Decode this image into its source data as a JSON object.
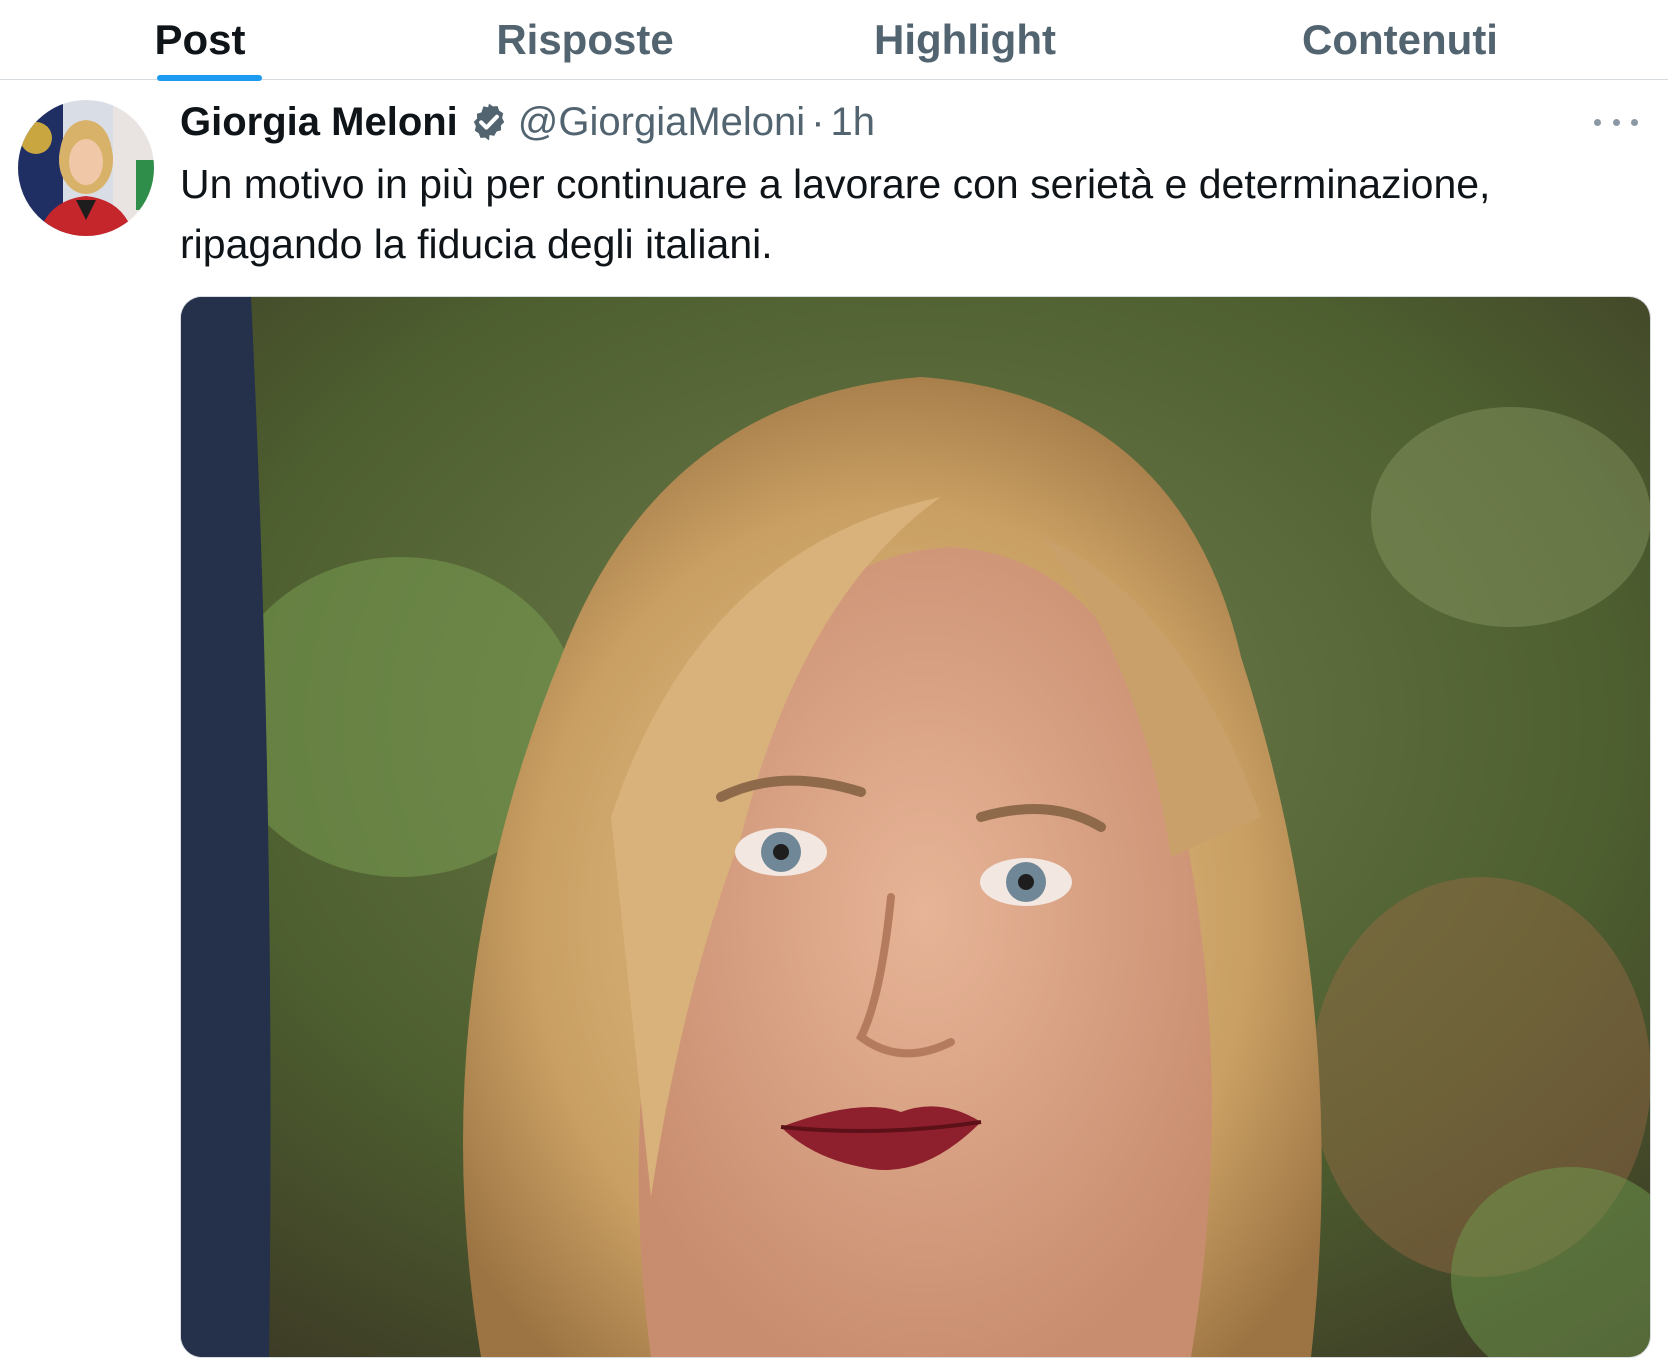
{
  "tabs": [
    {
      "label": "Post",
      "active": true
    },
    {
      "label": "Risposte",
      "active": false
    },
    {
      "label": "Highlight",
      "active": false
    },
    {
      "label": "Contenuti",
      "active": false
    }
  ],
  "tweet": {
    "author": {
      "display_name": "Giorgia Meloni",
      "handle": "@GiorgiaMeloni",
      "verified": true,
      "verified_icon": "verified-badge-icon",
      "avatar_icon": "avatar-photo"
    },
    "separator": "·",
    "time": "1h",
    "text": "Un motivo in più per continuare a lavorare con serietà e determinazione, ripagando la fiducia degli italiani.",
    "more_icon": "more-options-icon",
    "media_icon": "photo-portrait"
  },
  "colors": {
    "accent": "#1d9bf0",
    "text_primary": "#0f1419",
    "text_secondary": "#536471",
    "border": "#d7dce0"
  }
}
